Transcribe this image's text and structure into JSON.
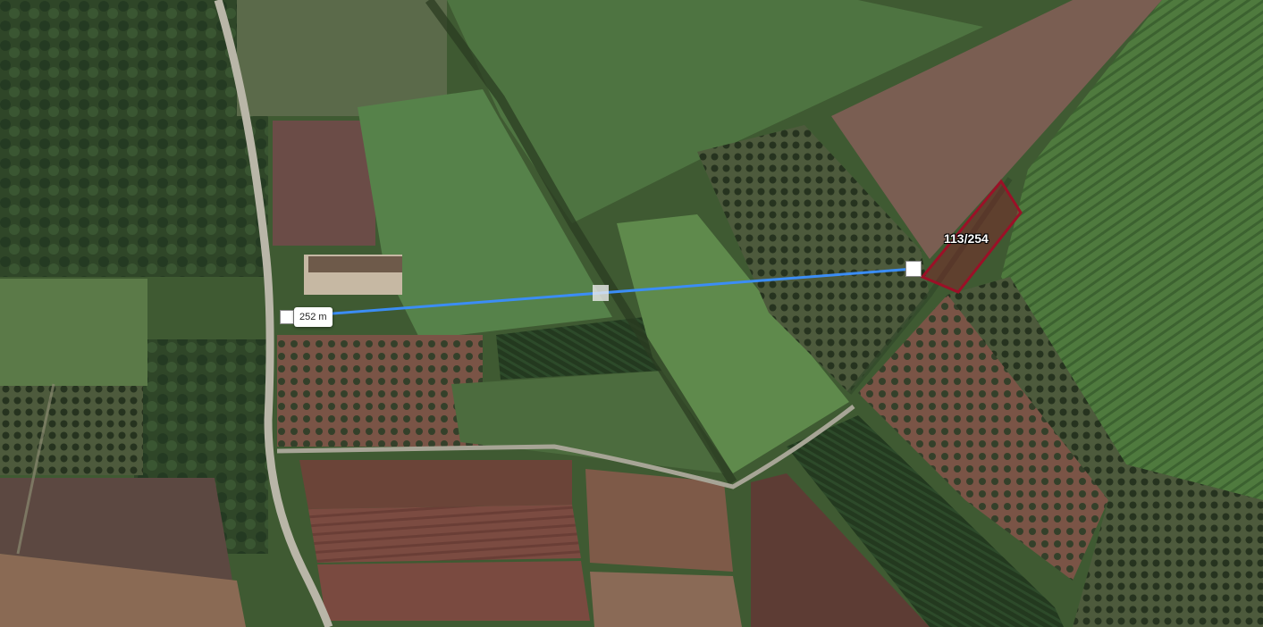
{
  "map": {
    "parcel": {
      "label": "113/254",
      "outline_color": "#9b1027",
      "fill_color": "rgba(155,16,39,0.35)"
    },
    "measurement": {
      "distance_label": "252 m",
      "line_color": "#3b8df5"
    },
    "colors": {
      "road": "#b9b6a8",
      "path": "#a7a596"
    }
  }
}
